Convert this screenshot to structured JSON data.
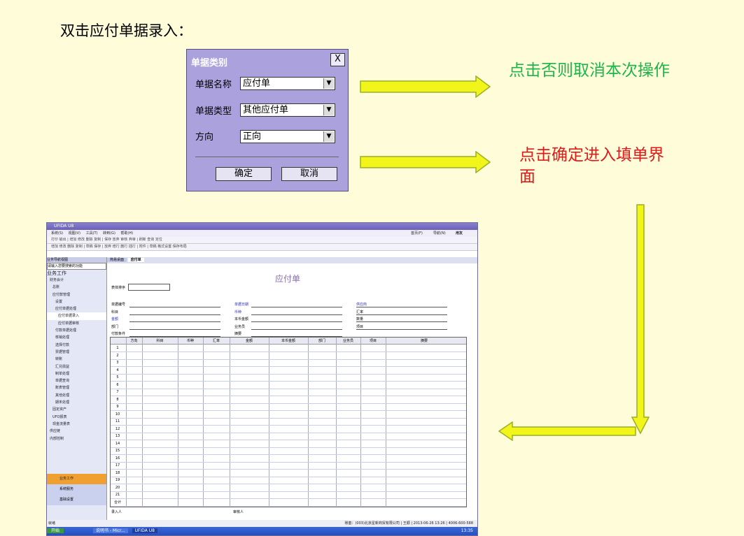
{
  "heading": "双击应付单据录入：",
  "dialog": {
    "title": "单据类别",
    "close_glyph": "X",
    "fields": [
      {
        "label": "单据名称",
        "value": "应付单"
      },
      {
        "label": "单据类型",
        "value": "其他应付单"
      },
      {
        "label": "方向",
        "value": "正向"
      }
    ],
    "ok_label": "确定",
    "cancel_label": "取消"
  },
  "notes": {
    "cancel_note": "点击否则取消本次操作",
    "ok_note": "点击确定进入填单界面"
  },
  "screenshot": {
    "window_title": "UFIDA U8",
    "menu": [
      "系统(S)",
      "视图(V)",
      "工具(T)",
      "转到(G)",
      "帮助(H)"
    ],
    "menu_right": [
      "首页(F)",
      "导航(N)",
      "用友"
    ],
    "toolbar1": "打印 输出 | 增加 修改 删除 复制 | 保存 放弃 审核 弃审 | 刷新 查询 定位",
    "toolbar2": "增加 修改 删除 复制 | 草稿 保存 | 放弃 增行 删行 插行 | 附件 | 草稿 格式设置 保存布局",
    "left_header": "业务导航视图",
    "left_search": "请输入您要搜索的功能",
    "left_section": "业务工作",
    "nav_items": [
      "财务会计",
      "总账",
      "应付款管理",
      "设置",
      "应付单据处理",
      "应付单据录入",
      "应付单据审核",
      "付款单据处理",
      "核销处理",
      "选择付款",
      "票据管理",
      "转账",
      "汇兑损益",
      "制单处理",
      "单据查询",
      "账表管理",
      "其他处理",
      "期末处理",
      "固定资产",
      "UFO报表",
      "现金流量表",
      "供应链",
      "内部控制"
    ],
    "bottom_nav": [
      "业务工作",
      "系统服务",
      "基础设置"
    ],
    "tabs": [
      "简易桌面",
      "应付单"
    ],
    "form_title": "应付单",
    "sort_label": "表体排序",
    "fields_col1": [
      "单据编号",
      "科目",
      "金额",
      "部门",
      "付款条件"
    ],
    "fields_col2": [
      "单据日期",
      "币种",
      "本币金额",
      "业务员",
      "摘要"
    ],
    "fields_col3": [
      "供应商",
      "汇率",
      "数量",
      "项目"
    ],
    "grid_headers": [
      "方向",
      "科目",
      "币种",
      "汇率",
      "金额",
      "本币金额",
      "部门",
      "业务员",
      "项目",
      "摘要"
    ],
    "row_numbers": [
      "1",
      "2",
      "3",
      "4",
      "5",
      "6",
      "7",
      "8",
      "9",
      "10",
      "11",
      "12",
      "13",
      "14",
      "15",
      "16",
      "17",
      "18",
      "19",
      "20",
      "21",
      "合计"
    ],
    "footer_left": "录入人",
    "footer_mid": "审核人",
    "status_left": "就绪",
    "status_right": "账套：(003)北京星新商贸有限公司 | 王顺 | 2013-06-26 13:26 | 4006-600-588",
    "taskbar_items": [
      "开始",
      "说明书 - Micr...",
      "UFIDA U8"
    ],
    "clock": "13:35"
  },
  "colors": {
    "background": "#fffdd9",
    "dialog_bg": "#aba2dd",
    "arrow_fill": "#f2f51a",
    "arrow_stroke": "#9aaf27",
    "green_text": "#1db54a",
    "red_text": "#e0191a"
  }
}
